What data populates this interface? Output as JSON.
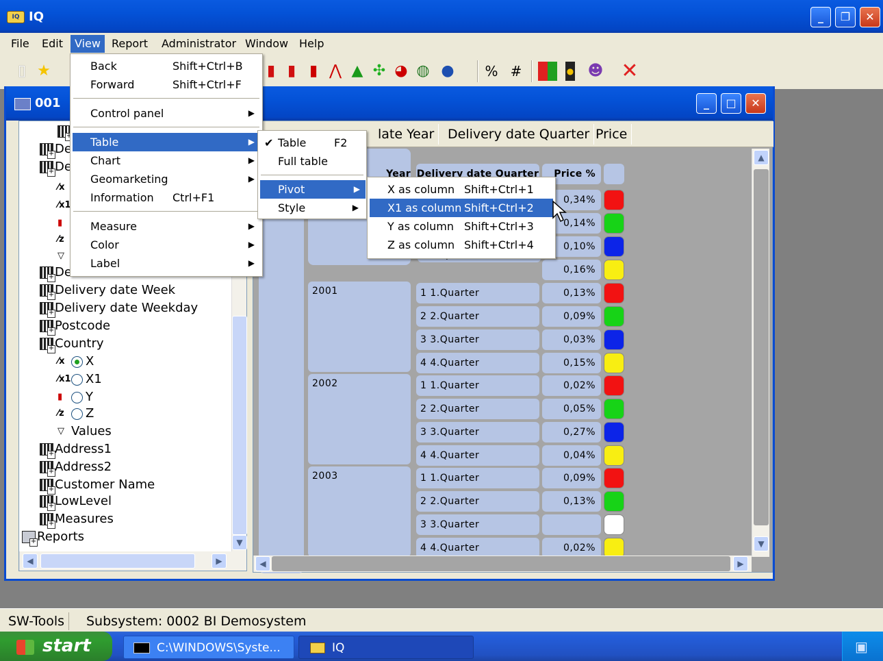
{
  "app": {
    "title": "IQ"
  },
  "menubar": [
    "File",
    "Edit",
    "View",
    "Report",
    "Administrator",
    "Window",
    "Help"
  ],
  "view_menu": {
    "items": [
      {
        "label": "Back",
        "shortcut": "Shift+Ctrl+B"
      },
      {
        "label": "Forward",
        "shortcut": "Shift+Ctrl+F"
      },
      {
        "label": "Control panel",
        "shortcut": ""
      },
      {
        "label": "Table",
        "shortcut": ""
      },
      {
        "label": "Chart",
        "shortcut": ""
      },
      {
        "label": "Geomarketing",
        "shortcut": ""
      },
      {
        "label": "Information",
        "shortcut": "Ctrl+F1"
      },
      {
        "label": "Measure",
        "shortcut": ""
      },
      {
        "label": "Color",
        "shortcut": ""
      },
      {
        "label": "Label",
        "shortcut": ""
      }
    ]
  },
  "table_menu": {
    "items": [
      {
        "label": "Table",
        "shortcut": "F2",
        "checked": "✔"
      },
      {
        "label": "Full table",
        "shortcut": ""
      },
      {
        "label": "Pivot",
        "shortcut": ""
      },
      {
        "label": "Style",
        "shortcut": ""
      }
    ]
  },
  "pivot_menu": {
    "items": [
      {
        "label": "X as column",
        "shortcut": "Shift+Ctrl+1"
      },
      {
        "label": "X1 as column",
        "shortcut": "Shift+Ctrl+2"
      },
      {
        "label": "Y as column",
        "shortcut": "Shift+Ctrl+3"
      },
      {
        "label": "Z as column",
        "shortcut": "Shift+Ctrl+4"
      }
    ]
  },
  "child": {
    "title": "001"
  },
  "tree": {
    "partial": [
      "De",
      "De",
      "De"
    ],
    "items": [
      "Delivery date Week",
      "Delivery date Weekday",
      "Postcode",
      "Country"
    ],
    "country_axes": [
      "X",
      "X1",
      "Y",
      "Z"
    ],
    "values_label": "Values",
    "tail_items": [
      "Address1",
      "Address2",
      "Customer Name",
      "LowLevel",
      "Measures"
    ],
    "reports": "Reports"
  },
  "grid": {
    "header_captions": [
      "late Year",
      "Delivery date Quarter",
      "Price"
    ],
    "col_headers": [
      "Year",
      "Delivery date Quarter",
      "Price %"
    ],
    "partial_row": "4 4.Quarter",
    "top_pcts": [
      "0,34%",
      "0,14%",
      "0,10%",
      "0,16%"
    ],
    "groups": [
      {
        "year": "2001",
        "rows": [
          {
            "q": "1 1.Quarter",
            "p": "0,13%",
            "c": "#f21212"
          },
          {
            "q": "2 2.Quarter",
            "p": "0,09%",
            "c": "#17d317"
          },
          {
            "q": "3 3.Quarter",
            "p": "0,03%",
            "c": "#0c24e8"
          },
          {
            "q": "4 4.Quarter",
            "p": "0,15%",
            "c": "#f8ee12"
          }
        ]
      },
      {
        "year": "2002",
        "rows": [
          {
            "q": "1 1.Quarter",
            "p": "0,02%",
            "c": "#f21212"
          },
          {
            "q": "2 2.Quarter",
            "p": "0,05%",
            "c": "#17d317"
          },
          {
            "q": "3 3.Quarter",
            "p": "0,27%",
            "c": "#0c24e8"
          },
          {
            "q": "4 4.Quarter",
            "p": "0,04%",
            "c": "#f8ee12"
          }
        ]
      },
      {
        "year": "2003",
        "rows": [
          {
            "q": "1 1.Quarter",
            "p": "0,09%",
            "c": "#f21212"
          },
          {
            "q": "2 2.Quarter",
            "p": "0,13%",
            "c": "#17d317"
          },
          {
            "q": "3 3.Quarter",
            "p": "",
            "c": "#ffffff"
          },
          {
            "q": "4 4.Quarter",
            "p": "0,02%",
            "c": "#f8ee12"
          }
        ]
      }
    ],
    "top_colors": [
      "#f21212",
      "#17d317",
      "#0c24e8",
      "#f8ee12"
    ]
  },
  "status": {
    "left": "SW-Tools",
    "right": "Subsystem: 0002 BI Demosystem"
  },
  "taskbar": {
    "start": "start",
    "tasks": [
      "C:\\WINDOWS\\Syste...",
      "IQ"
    ]
  },
  "toolbar": {
    "percent": "%",
    "hash": "#"
  }
}
